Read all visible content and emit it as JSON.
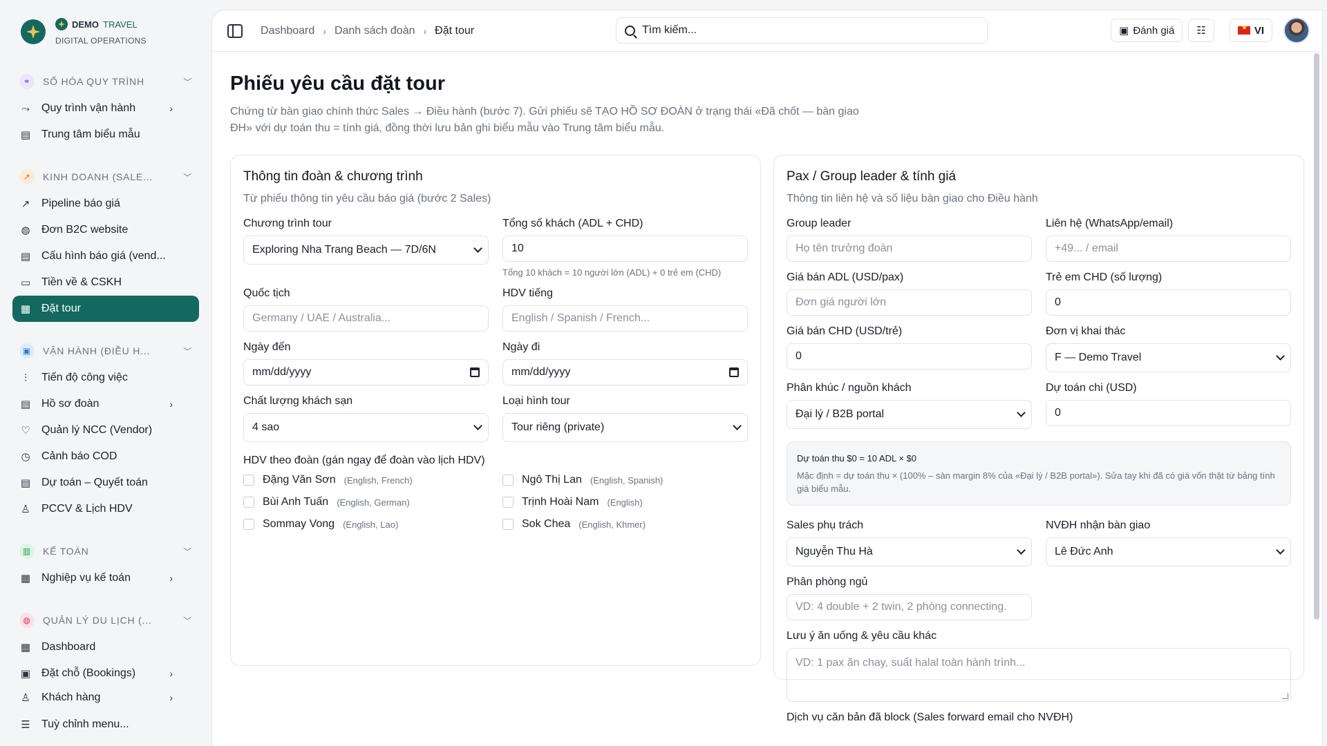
{
  "brand": {
    "name": "DEMO",
    "name2": "TRAVEL",
    "subtitle": "DIGITAL OPERATIONS"
  },
  "sidebar": {
    "groups": [
      {
        "label": "SỐ HÓA QUY TRÌNH",
        "items": [
          {
            "label": "Quy trình vận hành",
            "icon": "route-icon",
            "arrow": true
          },
          {
            "label": "Trung tâm biểu mẫu",
            "icon": "document-icon",
            "arrow": false
          }
        ]
      },
      {
        "label": "KINH DOANH (SALE...",
        "items": [
          {
            "label": "Pipeline báo giá",
            "icon": "trend-up-icon",
            "arrow": false
          },
          {
            "label": "Đơn B2C website",
            "icon": "globe-icon",
            "arrow": false
          },
          {
            "label": "Cấu hình báo giá (vend...",
            "icon": "document-icon",
            "arrow": false
          },
          {
            "label": "Tiền về & CSKH",
            "icon": "cash-icon",
            "arrow": false
          },
          {
            "label": "Đặt tour",
            "icon": "clipboard-icon",
            "arrow": false,
            "active": true
          }
        ]
      },
      {
        "label": "VẬN HÀNH (ĐIỀU H...",
        "items": [
          {
            "label": "Tiến độ công việc",
            "icon": "progress-icon",
            "arrow": false
          },
          {
            "label": "Hồ sơ đoàn",
            "icon": "folder-icon",
            "arrow": true
          },
          {
            "label": "Quản lý NCC (Vendor)",
            "icon": "handshake-icon",
            "arrow": false
          },
          {
            "label": "Cảnh báo COD",
            "icon": "alarm-icon",
            "arrow": false
          },
          {
            "label": "Dự toán – Quyết toán",
            "icon": "document-icon",
            "arrow": false
          },
          {
            "label": "PCCV & Lịch HDV",
            "icon": "user-icon",
            "arrow": false
          }
        ]
      },
      {
        "label": "KẾ TOÁN",
        "items": [
          {
            "label": "Nghiệp vụ kế toán",
            "icon": "calculator-icon",
            "arrow": true
          }
        ]
      },
      {
        "label": "QUẢN LÝ DU LỊCH (...",
        "items": [
          {
            "label": "Dashboard",
            "icon": "grid-icon",
            "arrow": false
          },
          {
            "label": "Đặt chỗ (Bookings)",
            "icon": "calendar-icon",
            "arrow": true
          },
          {
            "label": "Khách hàng",
            "icon": "users-icon",
            "arrow": true
          }
        ]
      }
    ],
    "customize": "Tuỳ chỉnh menu..."
  },
  "topbar": {
    "breadcrumb": [
      "Dashboard",
      "Danh sách đoàn",
      "Đặt tour"
    ],
    "search_placeholder": "Tìm kiếm...",
    "review_label": "Đánh giá",
    "lang_label": "VI"
  },
  "page": {
    "title": "Phiếu yêu cầu đặt tour",
    "lead": "Chứng từ bàn giao chính thức Sales → Điều hành (bước 7). Gửi phiếu sẽ TẠO HỒ SƠ ĐOÀN ở trạng thái «Đã chốt — bàn giao ĐH» với dự toán thu = tính giá, đồng thời lưu bản ghi biểu mẫu vào Trung tâm biểu mẫu."
  },
  "left_card": {
    "title": "Thông tin đoàn & chương trình",
    "subtitle": "Từ phiếu thông tin yêu cầu báo giá (bước 2 Sales)",
    "program_label": "Chương trình tour",
    "program_value": "Exploring Nha Trang Beach — 7D/6N",
    "pax_label": "Tổng số khách (ADL + CHD)",
    "pax_value": "10",
    "pax_hint": "Tổng 10 khách = 10 người lớn (ADL) + 0 trẻ em (CHD)",
    "nationality_label": "Quốc tịch",
    "nationality_placeholder": "Germany / UAE / Australia...",
    "guide_lang_label": "HDV tiếng",
    "guide_lang_placeholder": "English / Spanish / French...",
    "arrive_label": "Ngày đến",
    "arrive_value": "mm/dd/yyyy",
    "depart_label": "Ngày đi",
    "depart_value": "mm/dd/yyyy",
    "hotel_label": "Chất lượng khách sạn",
    "hotel_value": "4 sao",
    "tour_type_label": "Loại hình tour",
    "tour_type_value": "Tour riêng (private)",
    "guides_title": "HDV theo đoàn (gán ngay để đoàn vào lịch HDV)",
    "guides": [
      {
        "name": "Đặng Văn Sơn",
        "langs": "(English, French)"
      },
      {
        "name": "Ngô Thị Lan",
        "langs": "(English, Spanish)"
      },
      {
        "name": "Bùi Anh Tuấn",
        "langs": "(English, German)"
      },
      {
        "name": "Trịnh Hoài Nam",
        "langs": "(English)"
      },
      {
        "name": "Sommay Vong",
        "langs": "(English, Lao)"
      },
      {
        "name": "Sok Chea",
        "langs": "(English, Khmer)"
      }
    ]
  },
  "right_card": {
    "title": "Pax / Group leader & tính giá",
    "subtitle": "Thông tin liên hệ và số liệu bàn giao cho Điều hành",
    "leader_label": "Group leader",
    "leader_placeholder": "Họ tên trưởng đoàn",
    "contact_label": "Liên hệ (WhatsApp/email)",
    "contact_placeholder": "+49... / email",
    "adl_price_label": "Giá bán ADL (USD/pax)",
    "adl_price_placeholder": "Đơn giá người lớn",
    "chd_count_label": "Trẻ em CHD (số lượng)",
    "chd_count_value": "0",
    "chd_price_label": "Giá bán CHD (USD/trẻ)",
    "chd_price_value": "0",
    "operator_label": "Đơn vị khai thác",
    "operator_value": "F — Demo Travel",
    "segment_label": "Phân khúc / nguồn khách",
    "segment_value": "Đại lý / B2B portal",
    "cost_label": "Dự toán chi (USD)",
    "cost_value": "0",
    "estimate_line": "Dự toán thu $0 = 10 ADL × $0",
    "estimate_note": "Mặc định = dự toán thu × (100% – sàn margin 8% của «Đại lý / B2B portal»). Sửa tay khi đã có giá vốn thật từ bảng tính giá biểu mẫu.",
    "sales_label": "Sales phụ trách",
    "sales_value": "Nguyễn Thu Hà",
    "handover_label": "NVĐH nhận bàn giao",
    "handover_value": "Lê Đức Anh",
    "rooming_label": "Phân phòng ngủ",
    "rooming_placeholder": "VD: 4 double + 2 twin, 2 phòng connecting.",
    "notes_label": "Lưu ý ăn uống & yêu cầu khác",
    "notes_placeholder": "VD: 1 pax ăn chay, suất halal toàn hành trình...",
    "services_label": "Dịch vụ căn bản đã block (Sales forward email cho NVĐH)"
  }
}
